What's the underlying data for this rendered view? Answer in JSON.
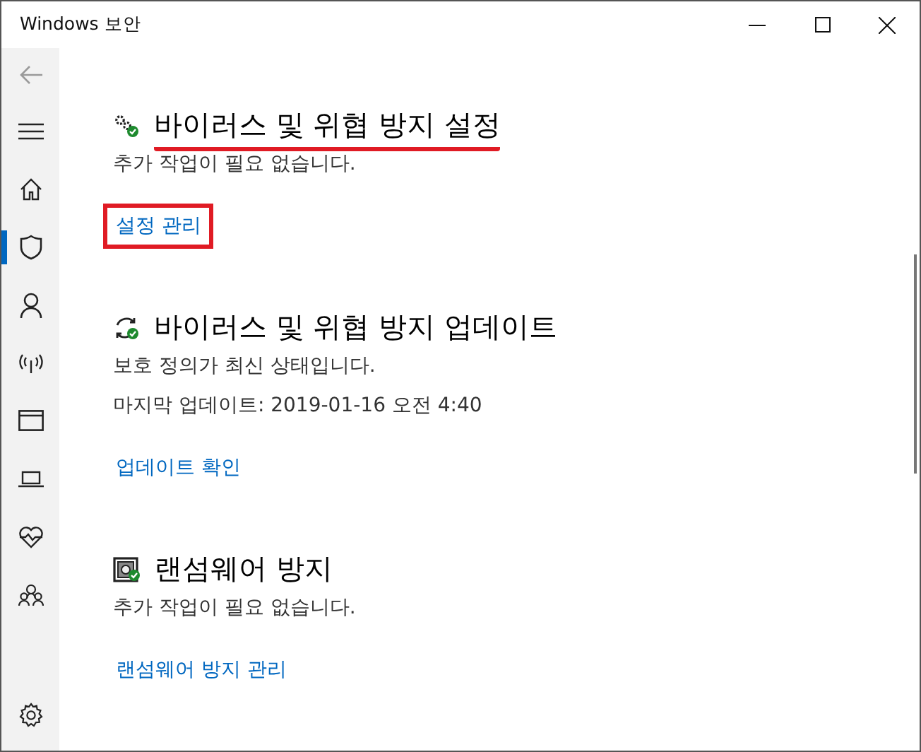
{
  "window": {
    "title": "Windows 보안"
  },
  "sidebar": {
    "items": [
      {
        "kind": "back",
        "selected": false
      },
      {
        "kind": "menu",
        "selected": false
      },
      {
        "kind": "home",
        "selected": false
      },
      {
        "kind": "shield",
        "selected": true
      },
      {
        "kind": "person",
        "selected": false
      },
      {
        "kind": "antenna",
        "selected": false
      },
      {
        "kind": "browser",
        "selected": false
      },
      {
        "kind": "laptop",
        "selected": false
      },
      {
        "kind": "heart",
        "selected": false
      },
      {
        "kind": "family",
        "selected": false
      },
      {
        "kind": "settings",
        "selected": false
      }
    ]
  },
  "sections": [
    {
      "kind": "gears",
      "title": "바이러스 및 위협 방지 설정",
      "lines": [
        "추가 작업이 필요 없습니다."
      ],
      "link": "설정 관리",
      "highlighted": true
    },
    {
      "kind": "refresh",
      "title": "바이러스 및 위협 방지 업데이트",
      "lines": [
        "보호 정의가 최신 상태입니다.",
        "마지막 업데이트: 2019-01-16 오전 4:40"
      ],
      "link": "업데이트 확인",
      "highlighted": false
    },
    {
      "kind": "safe",
      "title": "랜섬웨어 방지",
      "lines": [
        "추가 작업이 필요 없습니다."
      ],
      "link": "랜섬웨어 방지 관리",
      "highlighted": false
    }
  ]
}
